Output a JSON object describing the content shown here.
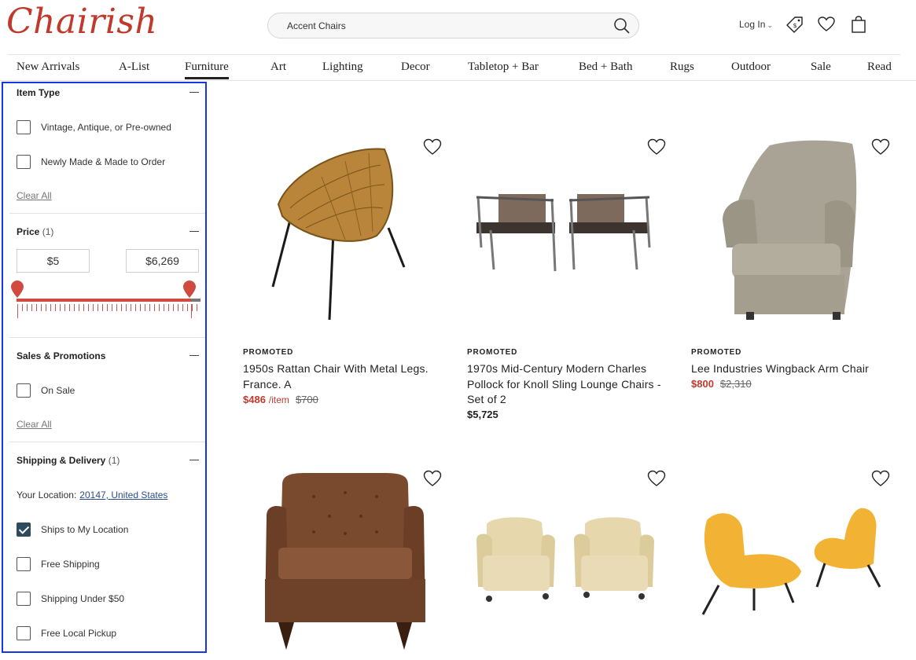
{
  "brand": {
    "logo_text": "Chairish",
    "accent": "#c0392b"
  },
  "search": {
    "value": "Accent Chairs"
  },
  "header": {
    "login_label": "Log In",
    "login_chevron": "⌄"
  },
  "nav": {
    "items": [
      {
        "label": "New Arrivals"
      },
      {
        "label": "A-List"
      },
      {
        "label": "Furniture",
        "active": true
      },
      {
        "label": "Art"
      },
      {
        "label": "Lighting"
      },
      {
        "label": "Decor"
      },
      {
        "label": "Tabletop + Bar"
      },
      {
        "label": "Bed + Bath"
      },
      {
        "label": "Rugs"
      },
      {
        "label": "Outdoor"
      },
      {
        "label": "Sale"
      },
      {
        "label": "Read"
      }
    ]
  },
  "filters": {
    "item_type": {
      "title": "Item Type",
      "options": [
        {
          "label": "Vintage, Antique, or Pre-owned",
          "checked": false
        },
        {
          "label": "Newly Made & Made to Order",
          "checked": false
        }
      ],
      "clear_label": "Clear All"
    },
    "price": {
      "title": "Price",
      "count": "(1)",
      "min": "$5",
      "max": "$6,269"
    },
    "sales": {
      "title": "Sales & Promotions",
      "options": [
        {
          "label": "On Sale",
          "checked": false
        }
      ],
      "clear_label": "Clear All"
    },
    "shipping": {
      "title": "Shipping & Delivery",
      "count": "(1)",
      "location_label": "Your Location:",
      "location_value": "20147, United States",
      "options": [
        {
          "label": "Ships to My Location",
          "checked": true
        },
        {
          "label": "Free Shipping",
          "checked": false
        },
        {
          "label": "Shipping Under $50",
          "checked": false
        },
        {
          "label": "Free Local Pickup",
          "checked": false
        }
      ]
    }
  },
  "products": [
    {
      "badge": "PROMOTED",
      "title": "1950s Rattan Chair With Metal Legs. France. A",
      "sale_price": "$486",
      "unit": "/item",
      "orig_price": "$700"
    },
    {
      "badge": "PROMOTED",
      "title": "1970s Mid-Century Modern Charles Pollock for Knoll Sling Lounge Chairs - Set of 2",
      "price": "$5,725"
    },
    {
      "badge": "PROMOTED",
      "title": "Lee Industries Wingback Arm Chair",
      "sale_price": "$800",
      "orig_price": "$2,310"
    },
    {
      "image": "tufted-leather-club-chair"
    },
    {
      "image": "pair-of-cream-leather-club-chairs"
    },
    {
      "image": "pair-of-yellow-lounge-chairs"
    }
  ]
}
